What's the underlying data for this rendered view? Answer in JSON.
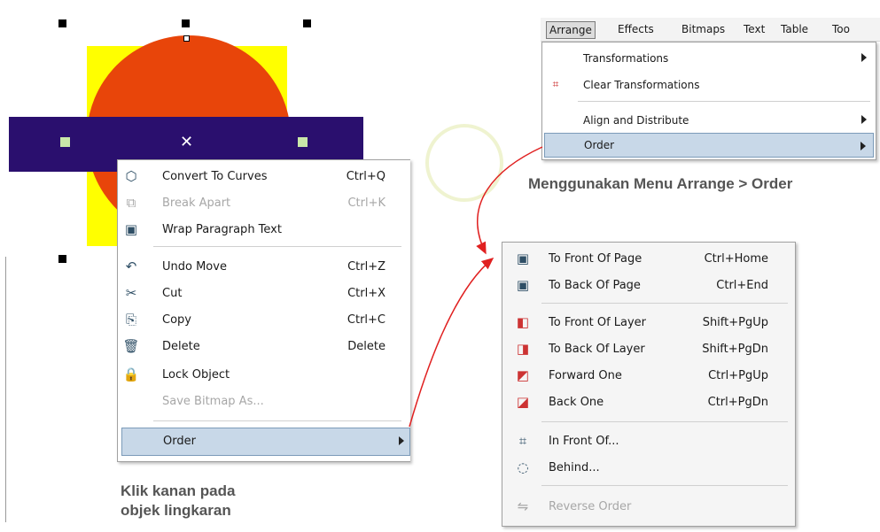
{
  "context_menu": {
    "items": [
      {
        "icon": "convert-curves-icon",
        "label": "Convert To Curves",
        "shortcut": "Ctrl+Q",
        "disabled": false
      },
      {
        "icon": "break-apart-icon",
        "label": "Break Apart",
        "shortcut": "Ctrl+K",
        "disabled": true
      },
      {
        "icon": "wrap-text-icon",
        "label": "Wrap Paragraph Text",
        "shortcut": "",
        "disabled": false
      },
      {
        "icon": "undo-icon",
        "label": "Undo Move",
        "shortcut": "Ctrl+Z",
        "disabled": false
      },
      {
        "icon": "cut-icon",
        "label": "Cut",
        "shortcut": "Ctrl+X",
        "disabled": false
      },
      {
        "icon": "copy-icon",
        "label": "Copy",
        "shortcut": "Ctrl+C",
        "disabled": false
      },
      {
        "icon": "delete-icon",
        "label": "Delete",
        "shortcut": "Delete",
        "disabled": false
      },
      {
        "icon": "lock-icon",
        "label": "Lock Object",
        "shortcut": "",
        "disabled": false
      },
      {
        "icon": "",
        "label": "Save Bitmap As...",
        "shortcut": "",
        "disabled": true
      },
      {
        "icon": "",
        "label": "Order",
        "shortcut": "",
        "disabled": false,
        "highlighted": true
      }
    ]
  },
  "menubar": {
    "items": [
      "Arrange",
      "Effects",
      "Bitmaps",
      "Text",
      "Table",
      "Too"
    ]
  },
  "arrange_menu": {
    "items": [
      {
        "label": "Transformations",
        "submenu": true
      },
      {
        "label": "Clear Transformations",
        "submenu": false
      },
      {
        "label": "Align and Distribute",
        "submenu": true
      },
      {
        "label": "Order",
        "submenu": true,
        "highlighted": true
      }
    ]
  },
  "order_menu": {
    "items": [
      {
        "icon": "front-page-icon",
        "label": "To Front Of Page",
        "shortcut": "Ctrl+Home",
        "disabled": false
      },
      {
        "icon": "back-page-icon",
        "label": "To Back Of Page",
        "shortcut": "Ctrl+End",
        "disabled": false
      },
      {
        "icon": "front-layer-icon",
        "label": "To Front Of Layer",
        "shortcut": "Shift+PgUp",
        "disabled": false
      },
      {
        "icon": "back-layer-icon",
        "label": "To Back Of Layer",
        "shortcut": "Shift+PgDn",
        "disabled": false
      },
      {
        "icon": "forward-one-icon",
        "label": "Forward One",
        "shortcut": "Ctrl+PgUp",
        "disabled": false
      },
      {
        "icon": "back-one-icon",
        "label": "Back One",
        "shortcut": "Ctrl+PgDn",
        "disabled": false
      },
      {
        "icon": "in-front-of-icon",
        "label": "In Front Of...",
        "shortcut": "",
        "disabled": false
      },
      {
        "icon": "behind-icon",
        "label": "Behind...",
        "shortcut": "",
        "disabled": false
      },
      {
        "icon": "reverse-order-icon",
        "label": "Reverse Order",
        "shortcut": "",
        "disabled": true
      }
    ]
  },
  "captions": {
    "menu_arrange": "Menggunakan Menu Arrange > Order",
    "right_click_line1": "Klik kanan pada",
    "right_click_line2": "objek lingkaran"
  },
  "colors": {
    "circle": "#e8450a",
    "square": "#ffff00",
    "bar": "#2a0f6e",
    "highlight": "#c8d8e8",
    "arrow": "#e02020"
  }
}
